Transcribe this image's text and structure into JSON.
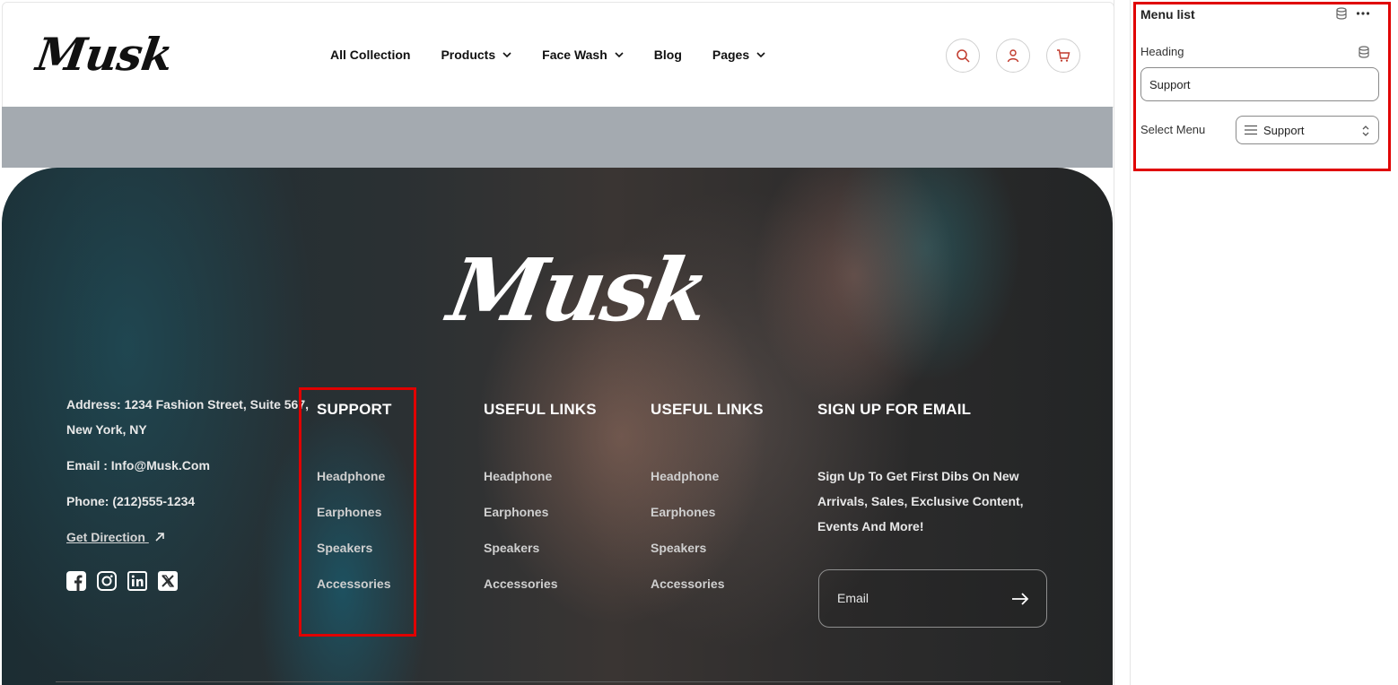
{
  "header": {
    "logo": "Musk",
    "nav": [
      {
        "label": "All Collection",
        "dropdown": false
      },
      {
        "label": "Products",
        "dropdown": true
      },
      {
        "label": "Face Wash",
        "dropdown": true
      },
      {
        "label": "Blog",
        "dropdown": false
      },
      {
        "label": "Pages",
        "dropdown": true
      }
    ],
    "icons": [
      "search-icon",
      "user-icon",
      "cart-icon"
    ],
    "icon_color": "#c0392b"
  },
  "footer": {
    "logo": "Musk",
    "address_line1": "Address: 1234 Fashion Street, Suite 567,",
    "address_line2": "New York, NY",
    "email": "Email : Info@Musk.Com",
    "phone": "Phone: (212)555-1234",
    "direction_label": "Get Direction",
    "social": [
      "facebook-icon",
      "instagram-icon",
      "linkedin-icon",
      "x-icon"
    ],
    "columns": [
      {
        "heading": "SUPPORT",
        "links": [
          "Headphone",
          "Earphones",
          "Speakers",
          "Accessories"
        ]
      },
      {
        "heading": "USEFUL LINKS",
        "links": [
          "Headphone",
          "Earphones",
          "Speakers",
          "Accessories"
        ]
      },
      {
        "heading": "USEFUL LINKS",
        "links": [
          "Headphone",
          "Earphones",
          "Speakers",
          "Accessories"
        ]
      }
    ],
    "signup": {
      "heading": "SIGN UP FOR EMAIL",
      "text_line1": "Sign Up To Get First Dibs On New",
      "text_line2": "Arrivals, Sales, Exclusive Content,",
      "text_line3": "Events And More!",
      "email_placeholder": "Email"
    }
  },
  "panel": {
    "title": "Menu list",
    "heading_label": "Heading",
    "heading_value": "Support",
    "select_label": "Select Menu",
    "select_value": "Support"
  },
  "colors": {
    "highlight": "#e00000",
    "band": "#a4aab0"
  }
}
